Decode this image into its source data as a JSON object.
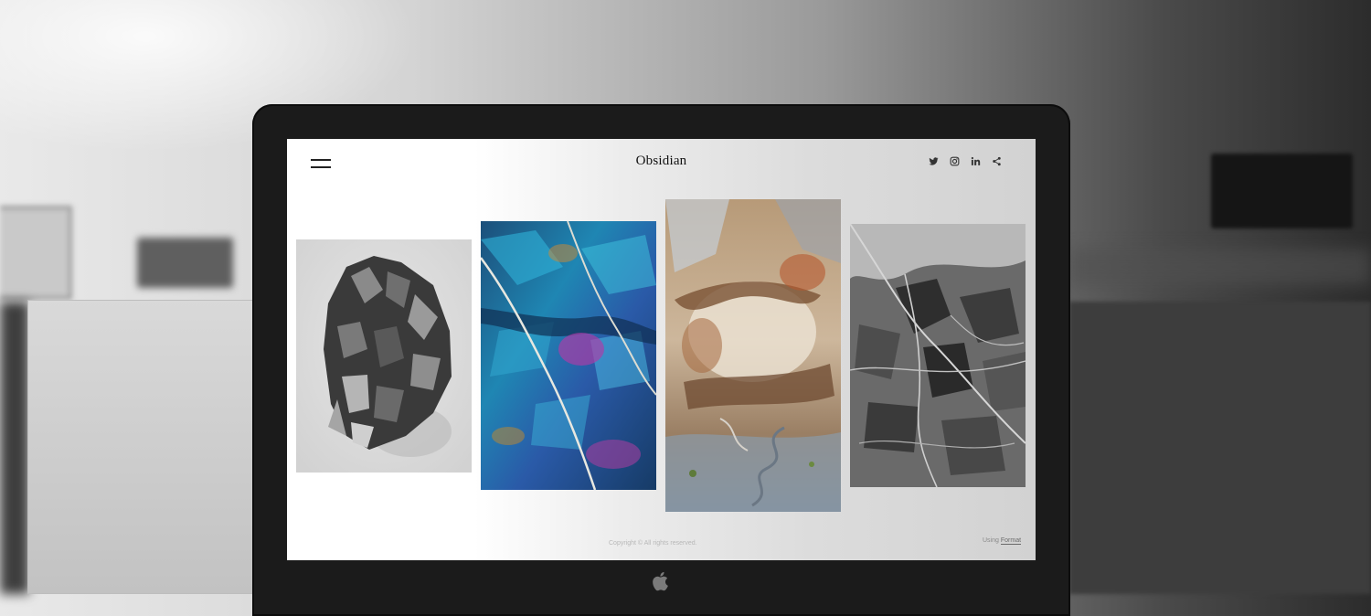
{
  "site": {
    "brand": "Obsidian",
    "menu_icon": "hamburger-menu-icon",
    "social_icons": [
      "twitter-icon",
      "instagram-icon",
      "linkedin-icon",
      "share-icon"
    ],
    "gallery": [
      {
        "subject": "Grayscale crystal cluster"
      },
      {
        "subject": "Iridescent blue mineral with white vein"
      },
      {
        "subject": "Aerial earth-tone landscape"
      },
      {
        "subject": "Grayscale cracked ice texture"
      }
    ],
    "footer": {
      "copyright": "Copyright © All rights reserved.",
      "using_prefix": "Using",
      "using_link": "Format"
    }
  },
  "colors": {
    "bezel": "#1b1b1b",
    "text": "#111111",
    "footer_text": "#b8b8b8"
  }
}
